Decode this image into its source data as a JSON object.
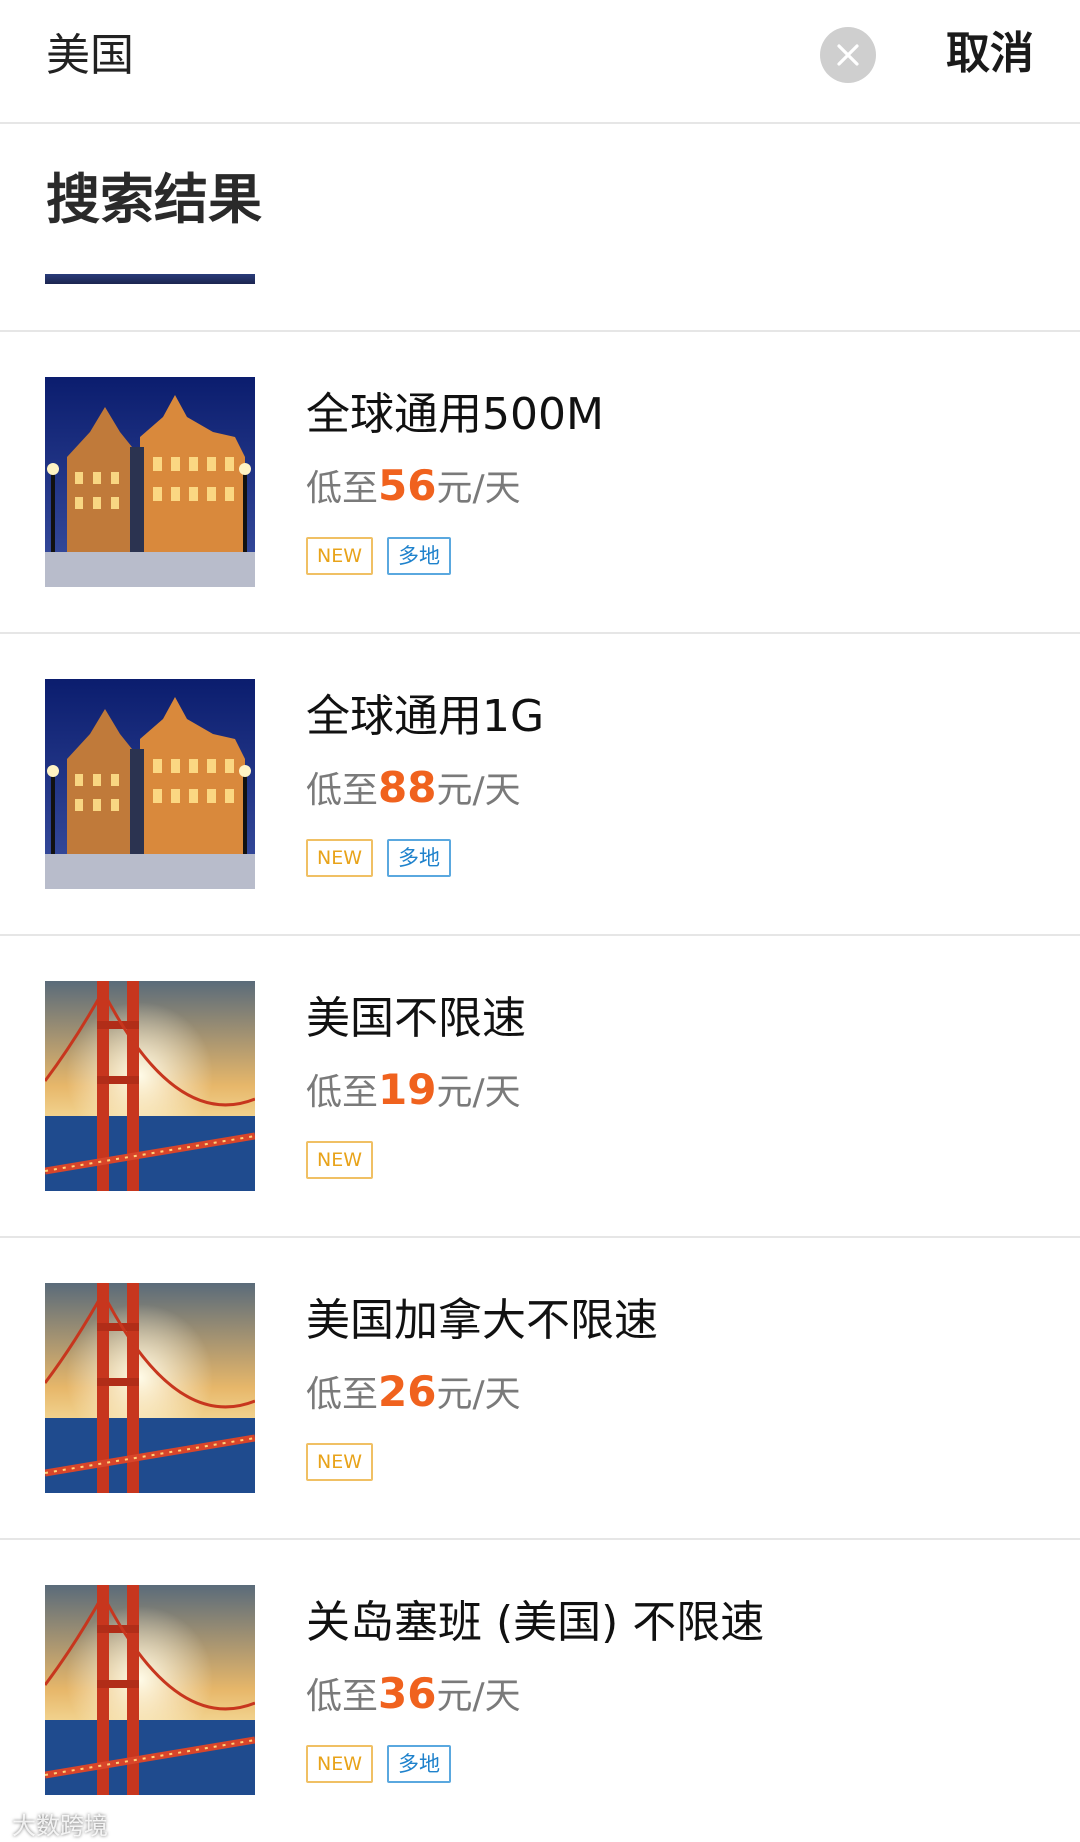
{
  "search": {
    "query": "美国",
    "cancel_label": "取消"
  },
  "section_title": "搜索结果",
  "accent_colors": {
    "price": "#f0621e",
    "new_tag": "#e8a31a",
    "multi_tag": "#1f82cc"
  },
  "items": [
    {
      "title": "全球通用500M",
      "price_prefix": "低至",
      "price": "56",
      "price_suffix": "元/天",
      "tags": [
        "NEW",
        "多地"
      ],
      "image": "riga-house-of-blackheads-night"
    },
    {
      "title": "全球通用1G",
      "price_prefix": "低至",
      "price": "88",
      "price_suffix": "元/天",
      "tags": [
        "NEW",
        "多地"
      ],
      "image": "riga-house-of-blackheads-night"
    },
    {
      "title": "美国不限速",
      "price_prefix": "低至",
      "price": "19",
      "price_suffix": "元/天",
      "tags": [
        "NEW"
      ],
      "image": "golden-gate-bridge-sunset"
    },
    {
      "title": "美国加拿大不限速",
      "price_prefix": "低至",
      "price": "26",
      "price_suffix": "元/天",
      "tags": [
        "NEW"
      ],
      "image": "golden-gate-bridge-sunset"
    },
    {
      "title": "关岛塞班 (美国) 不限速",
      "price_prefix": "低至",
      "price": "36",
      "price_suffix": "元/天",
      "tags": [
        "NEW",
        "多地"
      ],
      "image": "golden-gate-bridge-sunset"
    }
  ],
  "watermark": "大数跨境"
}
